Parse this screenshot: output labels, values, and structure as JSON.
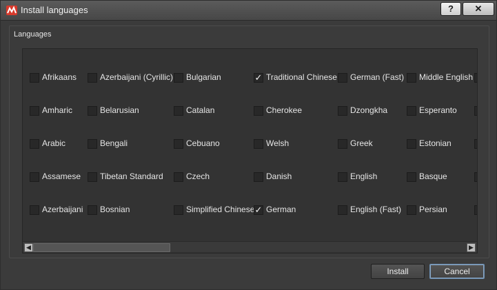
{
  "window": {
    "title": "Install languages",
    "help_label": "?",
    "close_label": "✕"
  },
  "group": {
    "label": "Languages"
  },
  "languages": [
    [
      {
        "label": "Afrikaans",
        "checked": false
      },
      {
        "label": "Azerbaijani (Cyrillic)",
        "checked": false
      },
      {
        "label": "Bulgarian",
        "checked": false
      },
      {
        "label": "Traditional Chinese",
        "checked": true
      },
      {
        "label": "German (Fast)",
        "checked": false
      },
      {
        "label": "Middle English",
        "checked": false
      }
    ],
    [
      {
        "label": "Amharic",
        "checked": false
      },
      {
        "label": "Belarusian",
        "checked": false
      },
      {
        "label": "Catalan",
        "checked": false
      },
      {
        "label": "Cherokee",
        "checked": false
      },
      {
        "label": "Dzongkha",
        "checked": false
      },
      {
        "label": "Esperanto",
        "checked": false
      }
    ],
    [
      {
        "label": "Arabic",
        "checked": false
      },
      {
        "label": "Bengali",
        "checked": false
      },
      {
        "label": "Cebuano",
        "checked": false
      },
      {
        "label": "Welsh",
        "checked": false
      },
      {
        "label": "Greek",
        "checked": false
      },
      {
        "label": "Estonian",
        "checked": false
      }
    ],
    [
      {
        "label": "Assamese",
        "checked": false
      },
      {
        "label": "Tibetan Standard",
        "checked": false
      },
      {
        "label": "Czech",
        "checked": false
      },
      {
        "label": "Danish",
        "checked": false
      },
      {
        "label": "English",
        "checked": false
      },
      {
        "label": "Basque",
        "checked": false
      }
    ],
    [
      {
        "label": "Azerbaijani",
        "checked": false
      },
      {
        "label": "Bosnian",
        "checked": false
      },
      {
        "label": "Simplified Chinese",
        "checked": false
      },
      {
        "label": "German",
        "checked": true
      },
      {
        "label": "English (Fast)",
        "checked": false
      },
      {
        "label": "Persian",
        "checked": false
      }
    ]
  ],
  "scrollbar": {
    "left_arrow": "◀",
    "right_arrow": "▶",
    "position_fraction": 0
  },
  "buttons": {
    "install": "Install",
    "cancel": "Cancel"
  },
  "colors": {
    "accent_border": "#6a8db0",
    "background": "#3b3b3b",
    "list_background": "#333333"
  },
  "icons": {
    "app": "app-logo-icon",
    "check": "checkmark-icon"
  }
}
